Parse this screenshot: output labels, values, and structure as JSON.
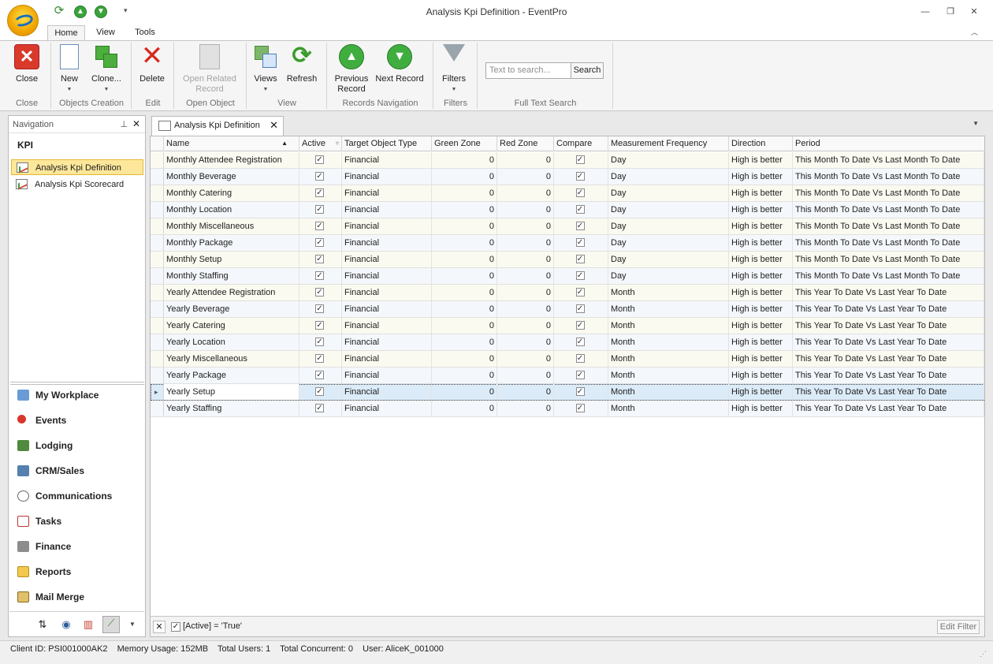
{
  "window": {
    "title": "Analysis Kpi Definition - EventPro"
  },
  "ribbon_tabs": [
    "Home",
    "View",
    "Tools"
  ],
  "ribbon": {
    "close": "Close",
    "new": "New",
    "clone": "Clone...",
    "delete": "Delete",
    "open_related_1": "Open Related",
    "open_related_2": "Record",
    "views": "Views",
    "refresh": "Refresh",
    "previous_1": "Previous",
    "previous_2": "Record",
    "next_record": "Next Record",
    "filters": "Filters",
    "search_placeholder": "Text to search...",
    "search_button": "Search",
    "groups": [
      "Close",
      "Objects Creation",
      "Edit",
      "Open Object",
      "View",
      "Records Navigation",
      "Filters",
      "Full Text Search"
    ]
  },
  "nav": {
    "header": "Navigation",
    "section": "KPI",
    "items": [
      "Analysis Kpi Definition",
      "Analysis Kpi Scorecard"
    ],
    "modules": [
      "My Workplace",
      "Events",
      "Lodging",
      "CRM/Sales",
      "Communications",
      "Tasks",
      "Finance",
      "Reports",
      "Mail Merge"
    ]
  },
  "doc_tab": {
    "label": "Analysis Kpi Definition"
  },
  "grid": {
    "columns": [
      "Name",
      "Active",
      "Target Object Type",
      "Green Zone",
      "Red Zone",
      "Compare",
      "Measurement Frequency",
      "Direction",
      "Period"
    ],
    "rows": [
      {
        "name": "Monthly Attendee Registration",
        "active": true,
        "target": "Financial",
        "green": "0",
        "red": "0",
        "compare": true,
        "freq": "Day",
        "direction": "High is better",
        "period": "This Month To Date Vs Last Month To Date"
      },
      {
        "name": "Monthly Beverage",
        "active": true,
        "target": "Financial",
        "green": "0",
        "red": "0",
        "compare": true,
        "freq": "Day",
        "direction": "High is better",
        "period": "This Month To Date Vs Last Month To Date"
      },
      {
        "name": "Monthly Catering",
        "active": true,
        "target": "Financial",
        "green": "0",
        "red": "0",
        "compare": true,
        "freq": "Day",
        "direction": "High is better",
        "period": "This Month To Date Vs Last Month To Date"
      },
      {
        "name": "Monthly Location",
        "active": true,
        "target": "Financial",
        "green": "0",
        "red": "0",
        "compare": true,
        "freq": "Day",
        "direction": "High is better",
        "period": "This Month To Date Vs Last Month To Date"
      },
      {
        "name": "Monthly Miscellaneous",
        "active": true,
        "target": "Financial",
        "green": "0",
        "red": "0",
        "compare": true,
        "freq": "Day",
        "direction": "High is better",
        "period": "This Month To Date Vs Last Month To Date"
      },
      {
        "name": "Monthly Package",
        "active": true,
        "target": "Financial",
        "green": "0",
        "red": "0",
        "compare": true,
        "freq": "Day",
        "direction": "High is better",
        "period": "This Month To Date Vs Last Month To Date"
      },
      {
        "name": "Monthly Setup",
        "active": true,
        "target": "Financial",
        "green": "0",
        "red": "0",
        "compare": true,
        "freq": "Day",
        "direction": "High is better",
        "period": "This Month To Date Vs Last Month To Date"
      },
      {
        "name": "Monthly Staffing",
        "active": true,
        "target": "Financial",
        "green": "0",
        "red": "0",
        "compare": true,
        "freq": "Day",
        "direction": "High is better",
        "period": "This Month To Date Vs Last Month To Date"
      },
      {
        "name": "Yearly Attendee Registration",
        "active": true,
        "target": "Financial",
        "green": "0",
        "red": "0",
        "compare": true,
        "freq": "Month",
        "direction": "High is better",
        "period": "This Year To Date Vs Last Year To Date"
      },
      {
        "name": "Yearly Beverage",
        "active": true,
        "target": "Financial",
        "green": "0",
        "red": "0",
        "compare": true,
        "freq": "Month",
        "direction": "High is better",
        "period": "This Year To Date Vs Last Year To Date"
      },
      {
        "name": "Yearly Catering",
        "active": true,
        "target": "Financial",
        "green": "0",
        "red": "0",
        "compare": true,
        "freq": "Month",
        "direction": "High is better",
        "period": "This Year To Date Vs Last Year To Date"
      },
      {
        "name": "Yearly Location",
        "active": true,
        "target": "Financial",
        "green": "0",
        "red": "0",
        "compare": true,
        "freq": "Month",
        "direction": "High is better",
        "period": "This Year To Date Vs Last Year To Date"
      },
      {
        "name": "Yearly Miscellaneous",
        "active": true,
        "target": "Financial",
        "green": "0",
        "red": "0",
        "compare": true,
        "freq": "Month",
        "direction": "High is better",
        "period": "This Year To Date Vs Last Year To Date"
      },
      {
        "name": "Yearly Package",
        "active": true,
        "target": "Financial",
        "green": "0",
        "red": "0",
        "compare": true,
        "freq": "Month",
        "direction": "High is better",
        "period": "This Year To Date Vs Last Year To Date"
      },
      {
        "name": "Yearly Setup",
        "active": true,
        "target": "Financial",
        "green": "0",
        "red": "0",
        "compare": true,
        "freq": "Month",
        "direction": "High is better",
        "period": "This Year To Date Vs Last Year To Date"
      },
      {
        "name": "Yearly Staffing",
        "active": true,
        "target": "Financial",
        "green": "0",
        "red": "0",
        "compare": true,
        "freq": "Month",
        "direction": "High is better",
        "period": "This Year To Date Vs Last Year To Date"
      }
    ]
  },
  "filter": {
    "text": "[Active] = 'True'",
    "edit": "Edit Filter"
  },
  "status": {
    "client": "Client ID: PSI001000AK2",
    "memory": "Memory Usage: 152MB",
    "users": "Total Users: 1",
    "concurrent": "Total Concurrent: 0",
    "user": "User: AliceK_001000"
  }
}
